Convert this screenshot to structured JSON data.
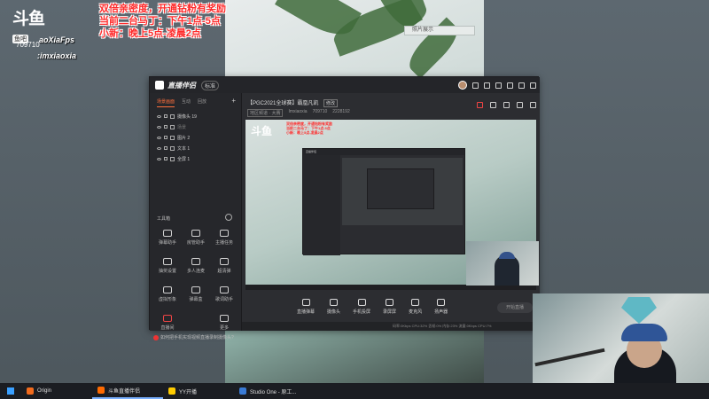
{
  "stream_overlay": {
    "logo_mark": "斗鱼",
    "logo_sub": "鱼吧",
    "room_number": "709710",
    "streamer_name": "aoXiaFps",
    "handle": ":imxiaoxia",
    "promo_lines": [
      "双倍亲密度，开通钻粉有奖励",
      "当前二台马丁：下午1点-5点",
      "小新：晚上5点-凌晨2点"
    ]
  },
  "background_photo": {
    "label": "照片展示"
  },
  "app": {
    "title": "直播伴侣",
    "version_badge": "标准",
    "sidebar_tabs": [
      "场景画面",
      "互动",
      "回放"
    ],
    "scenes": [
      {
        "label": "摄像头 19"
      },
      {
        "label": "场景"
      },
      {
        "label": "图片 2"
      },
      {
        "label": "文本 1"
      },
      {
        "label": "全屏 1"
      }
    ],
    "tools_header": "工具箱",
    "tools": [
      {
        "label": "弹幕助手"
      },
      {
        "label": "房管助手"
      },
      {
        "label": "主播任务"
      },
      {
        "label": "抽奖设置"
      },
      {
        "label": "多人连麦"
      },
      {
        "label": "超清弹"
      },
      {
        "label": "虚拟形象"
      },
      {
        "label": "弹幕盒"
      },
      {
        "label": "歌词助手"
      },
      {
        "label": "直播间"
      },
      {
        "label": ""
      },
      {
        "label": "更多"
      }
    ],
    "help_text": "如何把手机实现视频直播录制摄像头?",
    "room_title": "【PGC2021全球赛】霸凰凡凯",
    "modify_label": "修改",
    "room_meta": [
      "地区频道 · 大赛",
      "Imxiaoxia",
      "709710",
      "2228192"
    ],
    "controls": [
      {
        "label": "直播弹幕"
      },
      {
        "label": "摄像头"
      },
      {
        "label": "手机投屏"
      },
      {
        "label": "录屏屏"
      },
      {
        "label": "麦克风"
      },
      {
        "label": "扬声器"
      }
    ],
    "go_live": "开始直播",
    "status_bar": "码率:0Kbps  CPU:32%  丢帧:0%  内存:23%  流量:0Kbps  CPU:7%"
  },
  "taskbar": {
    "items": [
      {
        "label": "Origin",
        "color": "#f26b1d"
      },
      {
        "label": "斗鱼直播伴侣",
        "color": "#ff6a00"
      },
      {
        "label": "YY开播",
        "color": "#ffcc00"
      },
      {
        "label": "Studio One - 原工...",
        "color": "#3a7bd5"
      }
    ]
  },
  "colors": {
    "accent": "#ff6f3c",
    "overlay_red": "#ff2b2b"
  }
}
